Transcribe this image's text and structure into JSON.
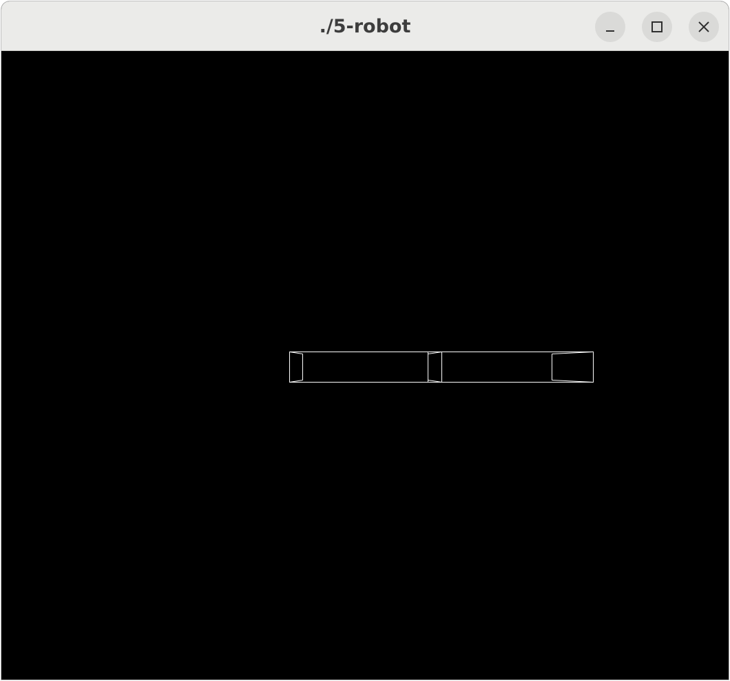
{
  "window": {
    "title": "./5-robot",
    "buttons": {
      "minimize": "minimize-icon",
      "maximize": "maximize-icon",
      "close": "close-icon"
    }
  },
  "scene": {
    "background": "#000000",
    "stroke_color": "#ffffff",
    "render_mode": "wireframe",
    "objects": [
      "robot-arm-upper-segment",
      "robot-arm-lower-segment"
    ]
  }
}
